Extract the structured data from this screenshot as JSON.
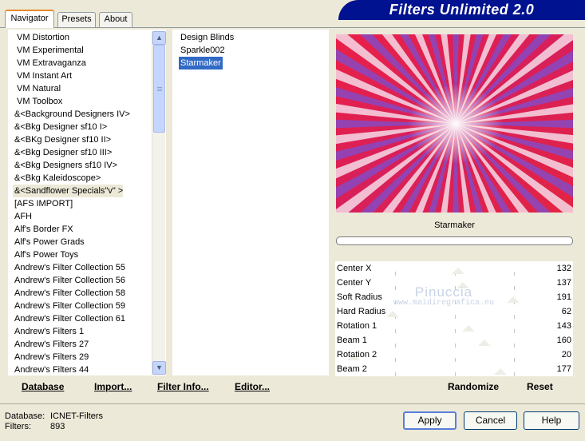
{
  "tabs": [
    {
      "label": "Navigator",
      "active": true
    },
    {
      "label": "Presets",
      "active": false
    },
    {
      "label": "About",
      "active": false
    }
  ],
  "app_title": "Filters Unlimited 2.0",
  "categories": [
    "VM Distortion",
    "VM Experimental",
    "VM Extravaganza",
    "VM Instant Art",
    "VM Natural",
    "VM Toolbox",
    "&<Background Designers IV>",
    "&<Bkg Designer sf10 I>",
    "&<BKg Designer sf10 II>",
    "&<Bkg Designer sf10 III>",
    "&<Bkg Designers sf10 IV>",
    "&<Bkg Kaleidoscope>",
    "&<Sandflower Specials\"v\" >",
    "[AFS IMPORT]",
    "AFH",
    "Alf's Border FX",
    "Alf's Power Grads",
    "Alf's Power Toys",
    "Andrew's Filter Collection 55",
    "Andrew's Filter Collection 56",
    "Andrew's Filter Collection 58",
    "Andrew's Filter Collection 59",
    "Andrew's Filter Collection 61",
    "Andrew's Filters 1",
    "Andrew's Filters 27",
    "Andrew's Filters 29",
    "Andrew's Filters 44"
  ],
  "selected_category_index": 12,
  "filters": [
    "Design Blinds",
    "Sparkle002",
    "Starmaker"
  ],
  "selected_filter_index": 2,
  "preview_title": "Starmaker",
  "sliders": [
    {
      "label": "Center X",
      "value": "132",
      "level": 0.518
    },
    {
      "label": "Center Y",
      "value": "137",
      "level": 0.537
    },
    {
      "label": "Soft Radius",
      "value": "191",
      "level": 0.749
    },
    {
      "label": "Hard Radius",
      "value": "62",
      "level": 0.243
    },
    {
      "label": "Rotation 1",
      "value": "143",
      "level": 0.561
    },
    {
      "label": "Beam 1",
      "value": "160",
      "level": 0.627
    },
    {
      "label": "Rotation 2",
      "value": "20",
      "level": 0.078
    },
    {
      "label": "Beam 2",
      "value": "177",
      "level": 0.694
    }
  ],
  "watermark": {
    "line1": "Pinuccia",
    "line2": "www.maidiregrafica.eu"
  },
  "toolbar": {
    "database": "Database",
    "import": "Import...",
    "filter_info": "Filter Info...",
    "editor": "Editor...",
    "randomize": "Randomize",
    "reset": "Reset"
  },
  "status": {
    "database_label": "Database:",
    "database_value": "ICNET-Filters",
    "filters_label": "Filters:",
    "filters_value": "893"
  },
  "buttons": {
    "apply": "Apply",
    "cancel": "Cancel",
    "help": "Help"
  },
  "colors": {
    "banner": "#00128f",
    "selection": "#316ac5",
    "preview_red": "#e8244c",
    "preview_purple": "#6a3fc8"
  }
}
